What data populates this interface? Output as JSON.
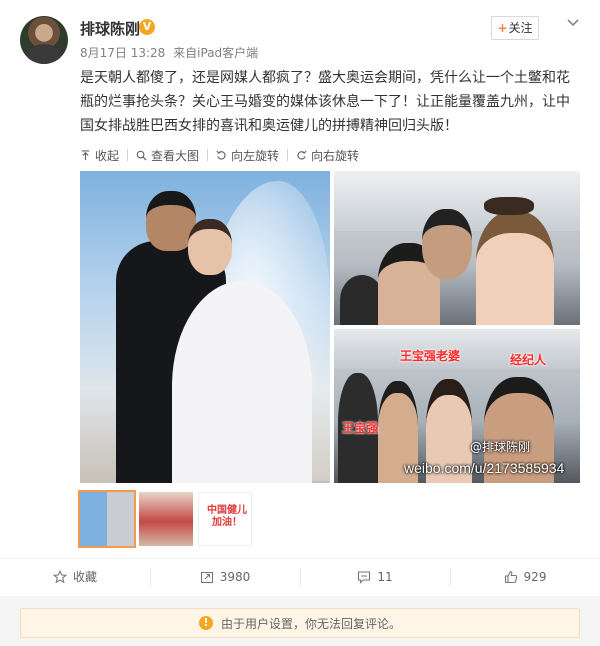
{
  "header": {
    "username": "排球陈刚",
    "verified_badge": "V",
    "date": "8月17日 13:28",
    "source_prefix": "来自",
    "source": "iPad客户端",
    "follow_label": "关注",
    "follow_plus": "+"
  },
  "post": {
    "text": "是天朝人都傻了，还是网媒人都疯了？盛大奥运会期间，凭什么让一个土鳖和花瓶的烂事抢头条？关心王马婚变的媒体该休息一下了！让正能量覆盖九州，让中国女排战胜巴西女排的喜讯和奥运健儿的拼搏精神回归头版！"
  },
  "toolbar": {
    "collapse": "收起",
    "view_large": "查看大图",
    "rotate_left": "向左旋转",
    "rotate_right": "向右旋转"
  },
  "photo": {
    "label_mr_wang": "王宝强老婆",
    "label_agent": "经纪人",
    "label_wang": "王宝强",
    "watermark_handle": "@排球陈刚",
    "watermark_url": "weibo.com/u/2173585934"
  },
  "thumbs": {
    "third_text": "中国健儿加油！"
  },
  "actions": {
    "favorite": "收藏",
    "reposts": "3980",
    "comments": "11",
    "likes": "929"
  },
  "notice": {
    "text": "由于用户设置，你无法回复评论。"
  },
  "colors": {
    "accent_orange": "#ff8140",
    "badge_gold": "#f5a623",
    "label_red": "#ff2b2b"
  },
  "icons": [
    "v-verified-icon",
    "chevron-down-icon",
    "collapse-up-icon",
    "magnifier-icon",
    "rotate-left-icon",
    "rotate-right-icon",
    "star-icon",
    "repost-icon",
    "comment-icon",
    "thumbs-up-icon",
    "alert-icon"
  ]
}
